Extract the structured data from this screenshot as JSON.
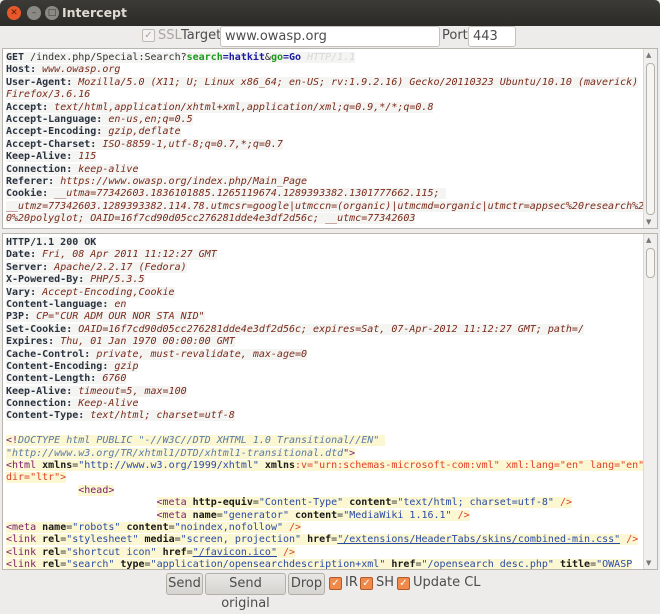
{
  "window": {
    "title": "Intercept"
  },
  "toolbar": {
    "ssl_label": "SSL",
    "ssl_checked": true,
    "target_label": "Target",
    "target_value": "www.owasp.org",
    "port_label": "Port",
    "port_value": "443"
  },
  "request": {
    "lines": [
      [
        [
          "k",
          "GET"
        ],
        [
          "p",
          " /index.php/Special:Search?"
        ],
        [
          "g",
          "search"
        ],
        [
          "b",
          "="
        ],
        [
          "b",
          "hatkit"
        ],
        [
          "p",
          "&"
        ],
        [
          "g",
          "go"
        ],
        [
          "b",
          "="
        ],
        [
          "b",
          "Go"
        ],
        [
          "f",
          " HTTP/1.1"
        ]
      ],
      [
        [
          "k",
          "Host:"
        ],
        [
          "v",
          " www.owasp.org"
        ]
      ],
      [
        [
          "k",
          "User-Agent:"
        ],
        [
          "v",
          " Mozilla/5.0 (X11; U; Linux x86_64; en-US; rv:1.9.2.16) Gecko/20110323 Ubuntu/10.10 (maverick)"
        ]
      ],
      [
        [
          "v",
          "Firefox/3.6.16"
        ]
      ],
      [
        [
          "k",
          "Accept:"
        ],
        [
          "v",
          " text/html,application/xhtml+xml,application/xml;q=0.9,*/*;q=0.8"
        ]
      ],
      [
        [
          "k",
          "Accept-Language:"
        ],
        [
          "v",
          " en-us,en;q=0.5"
        ]
      ],
      [
        [
          "k",
          "Accept-Encoding:"
        ],
        [
          "v",
          " gzip,deflate"
        ]
      ],
      [
        [
          "k",
          "Accept-Charset:"
        ],
        [
          "v",
          " ISO-8859-1,utf-8;q=0.7,*;q=0.7"
        ]
      ],
      [
        [
          "k",
          "Keep-Alive:"
        ],
        [
          "v",
          " 115"
        ]
      ],
      [
        [
          "k",
          "Connection:"
        ],
        [
          "v",
          " keep-alive"
        ]
      ],
      [
        [
          "k",
          "Referer:"
        ],
        [
          "v",
          " https://www.owasp.org/index.php/Main_Page"
        ]
      ],
      [
        [
          "k",
          "Cookie:"
        ],
        [
          "v",
          " __utma=77342603.1836101885.1265119674.1289393382.1301777662.115; "
        ]
      ],
      [
        [
          "v",
          "__utmz=77342603.1289393382.114.78.utmcsr=google|utmccn=(organic)|utmcmd=organic|utmctr=appsec%20research%20201"
        ]
      ],
      [
        [
          "v",
          "0%20polyglot; OAID=16f7cd90d05cc276281dde4e3df2d56c; __utmc=77342603"
        ]
      ]
    ]
  },
  "response": {
    "lines": [
      [
        [
          "k",
          "HTTP/1.1 200 OK"
        ]
      ],
      [
        [
          "k",
          "Date:"
        ],
        [
          "v",
          " Fri, 08 Apr 2011 11:12:27 GMT"
        ]
      ],
      [
        [
          "k",
          "Server:"
        ],
        [
          "v",
          " Apache/2.2.17 (Fedora)"
        ]
      ],
      [
        [
          "k",
          "X-Powered-By:"
        ],
        [
          "v",
          " PHP/5.3.5"
        ]
      ],
      [
        [
          "k",
          "Vary:"
        ],
        [
          "v",
          " Accept-Encoding,Cookie"
        ]
      ],
      [
        [
          "k",
          "Content-language:"
        ],
        [
          "v",
          " en"
        ]
      ],
      [
        [
          "k",
          "P3P:"
        ],
        [
          "v",
          " CP=\"CUR ADM OUR NOR STA NID\""
        ]
      ],
      [
        [
          "k",
          "Set-Cookie:"
        ],
        [
          "v",
          " OAID=16f7cd90d05cc276281dde4e3df2d56c; expires=Sat, 07-Apr-2012 11:12:27 GMT; path=/"
        ]
      ],
      [
        [
          "k",
          "Expires:"
        ],
        [
          "v",
          " Thu, 01 Jan 1970 00:00:00 GMT"
        ]
      ],
      [
        [
          "k",
          "Cache-Control:"
        ],
        [
          "v",
          " private, must-revalidate, max-age=0"
        ]
      ],
      [
        [
          "k",
          "Content-Encoding:"
        ],
        [
          "v",
          " gzip"
        ]
      ],
      [
        [
          "k",
          "Content-Length:"
        ],
        [
          "v",
          " 6760"
        ]
      ],
      [
        [
          "k",
          "Keep-Alive:"
        ],
        [
          "v",
          " timeout=5, max=100"
        ]
      ],
      [
        [
          "k",
          "Connection:"
        ],
        [
          "v",
          " Keep-Alive"
        ]
      ],
      [
        [
          "k",
          "Content-Type:"
        ],
        [
          "v",
          " text/html; charset=utf-8"
        ]
      ],
      [
        [
          "blank",
          " "
        ]
      ],
      [
        [
          "t",
          "<!"
        ],
        [
          "d",
          "DOCTYPE html PUBLIC \"-//W3C//DTD XHTML 1.0 Transitional//EN\" "
        ]
      ],
      [
        [
          "d",
          "\"http://www.w3.org/TR/xhtml1/DTD/xhtml1-transitional.dtd"
        ],
        [
          "t",
          "\">"
        ]
      ],
      [
        [
          "t",
          "<html"
        ],
        [
          "a",
          " xmlns"
        ],
        [
          "o",
          "="
        ],
        [
          "s",
          "\"http://www.w3.org/1999/xhtml\""
        ],
        [
          "a",
          " xmlns"
        ],
        [
          "r",
          ":v=\"urn:schemas-microsoft-com:vml\" xml:lang=\"en\" lang=\"en\" "
        ]
      ],
      [
        [
          "r",
          "dir=\"ltr\">"
        ]
      ],
      [
        [
          "blank",
          "            "
        ],
        [
          "t",
          "<head>"
        ]
      ],
      [
        [
          "blank",
          "                         "
        ],
        [
          "t",
          "<meta"
        ],
        [
          "a",
          " http-equiv"
        ],
        [
          "o",
          "="
        ],
        [
          "s",
          "\"Content-Type\""
        ],
        [
          "a",
          " content"
        ],
        [
          "o",
          "="
        ],
        [
          "s",
          "\"text/html; charset=utf-8\""
        ],
        [
          "r",
          " />"
        ]
      ],
      [
        [
          "blank",
          "                         "
        ],
        [
          "t",
          "<meta"
        ],
        [
          "a",
          " name"
        ],
        [
          "o",
          "="
        ],
        [
          "s",
          "\"generator\""
        ],
        [
          "a",
          " content"
        ],
        [
          "o",
          "="
        ],
        [
          "s",
          "\"MediaWiki 1.16.1\""
        ],
        [
          "r",
          " />"
        ]
      ],
      [
        [
          "t",
          "<meta"
        ],
        [
          "a",
          " name"
        ],
        [
          "o",
          "="
        ],
        [
          "s",
          "\"robots\""
        ],
        [
          "a",
          " content"
        ],
        [
          "o",
          "="
        ],
        [
          "s",
          "\"noindex,nofollow\""
        ],
        [
          "r",
          " />"
        ]
      ],
      [
        [
          "t",
          "<link"
        ],
        [
          "a",
          " rel"
        ],
        [
          "o",
          "="
        ],
        [
          "s",
          "\"stylesheet\""
        ],
        [
          "a",
          " media"
        ],
        [
          "o",
          "="
        ],
        [
          "s",
          "\"screen, projection\""
        ],
        [
          "a",
          " href"
        ],
        [
          "o",
          "="
        ],
        [
          "u",
          "\"/extensions/HeaderTabs/skins/combined-min.css\""
        ],
        [
          "r",
          " />"
        ]
      ],
      [
        [
          "t",
          "<link"
        ],
        [
          "a",
          " rel"
        ],
        [
          "o",
          "="
        ],
        [
          "s",
          "\"shortcut icon\""
        ],
        [
          "a",
          " href"
        ],
        [
          "o",
          "="
        ],
        [
          "u",
          "\"/favicon.ico\""
        ],
        [
          "r",
          " />"
        ]
      ],
      [
        [
          "t",
          "<link"
        ],
        [
          "a",
          " rel"
        ],
        [
          "o",
          "="
        ],
        [
          "s",
          "\"search\""
        ],
        [
          "a",
          " type"
        ],
        [
          "o",
          "="
        ],
        [
          "s",
          "\"application/opensearchdescription+xml\""
        ],
        [
          "a",
          " href"
        ],
        [
          "o",
          "="
        ],
        [
          "s",
          "\"/opensearch_desc.php\""
        ],
        [
          "a",
          " title"
        ],
        [
          "o",
          "="
        ],
        [
          "s",
          "\"OWASP"
        ]
      ]
    ]
  },
  "actions": {
    "send": "Send",
    "send_original": "Send original",
    "drop": "Drop",
    "ir_label": "IR",
    "sh_label": "SH",
    "update_cl_label": "Update CL",
    "check": "✓"
  },
  "colors": {
    "accent": "#f08a4b",
    "titlebar": "#3c3b37"
  }
}
